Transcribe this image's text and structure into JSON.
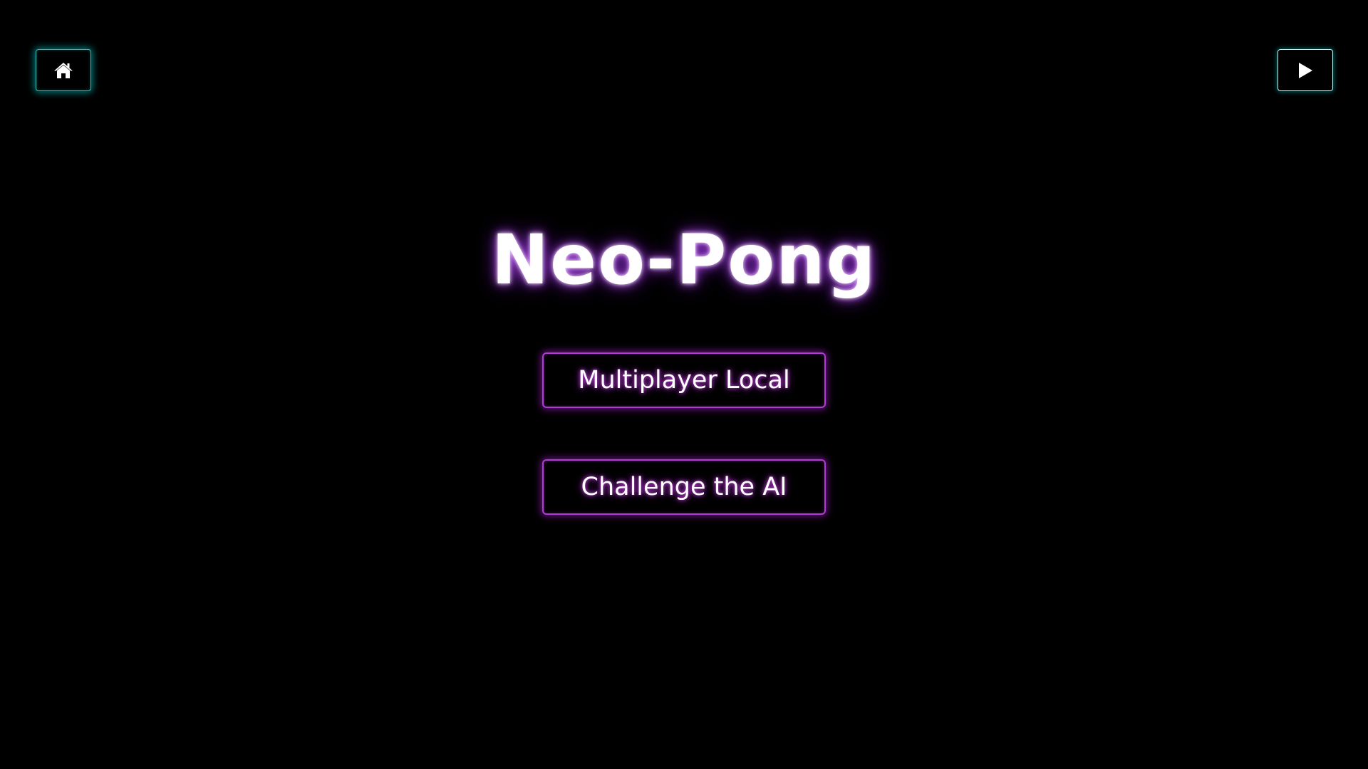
{
  "nav": {
    "home_icon": "home-icon",
    "play_icon": "play-icon"
  },
  "title": "Neo-Pong",
  "menu": {
    "multiplayer_label": "Multiplayer Local",
    "ai_label": "Challenge the AI"
  },
  "colors": {
    "background": "#000000",
    "cyan_accent": "#00dcdc",
    "magenta_accent": "#b23bd8",
    "title_glow": "#a028ff"
  }
}
